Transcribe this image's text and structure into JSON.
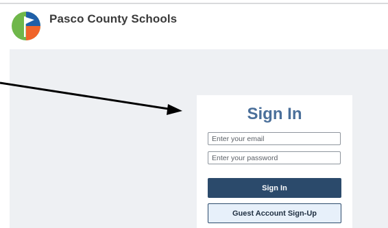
{
  "header": {
    "org_name": "Pasco County Schools",
    "logo_icon": "pasco-schools-logo-icon"
  },
  "signin": {
    "title": "Sign In",
    "email_placeholder": "Enter your email",
    "password_placeholder": "Enter your password",
    "submit_label": "Sign In",
    "guest_label": "Guest Account Sign-Up"
  },
  "colors": {
    "title": "#4a6f9a",
    "primary_button": "#2b4a6b",
    "secondary_button_bg": "#e7f0fa",
    "page_background": "#eef0f3",
    "logo_green": "#6fb74a",
    "logo_blue": "#1f5fa8",
    "logo_orange": "#f0642a"
  },
  "annotation": {
    "icon": "arrow-pointer-icon"
  }
}
